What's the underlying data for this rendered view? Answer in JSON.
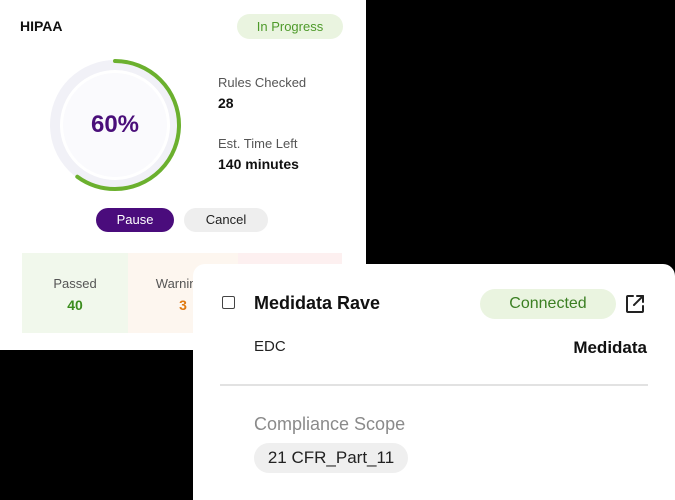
{
  "scan": {
    "title": "HIPAA",
    "status": "In Progress",
    "progress_percent": 60,
    "progress_label": "60%",
    "rules_checked_label": "Rules Checked",
    "rules_checked_value": "28",
    "time_left_label": "Est. Time Left",
    "time_left_value": "140 minutes",
    "pause_label": "Pause",
    "cancel_label": "Cancel",
    "tiles": [
      {
        "label": "Passed",
        "value": "40"
      },
      {
        "label": "Warnings",
        "value": "3"
      }
    ],
    "colors": {
      "accent": "#4a0c7c",
      "progress": "#6bb02e",
      "track": "#f1f1f7"
    }
  },
  "integration": {
    "name": "Medidata Rave",
    "status": "Connected",
    "type": "EDC",
    "vendor": "Medidata",
    "scope_label": "Compliance Scope",
    "scope_tag": "21 CFR_Part_11",
    "external_icon": "external-link-icon",
    "checkbox_icon": "checkbox-icon"
  }
}
